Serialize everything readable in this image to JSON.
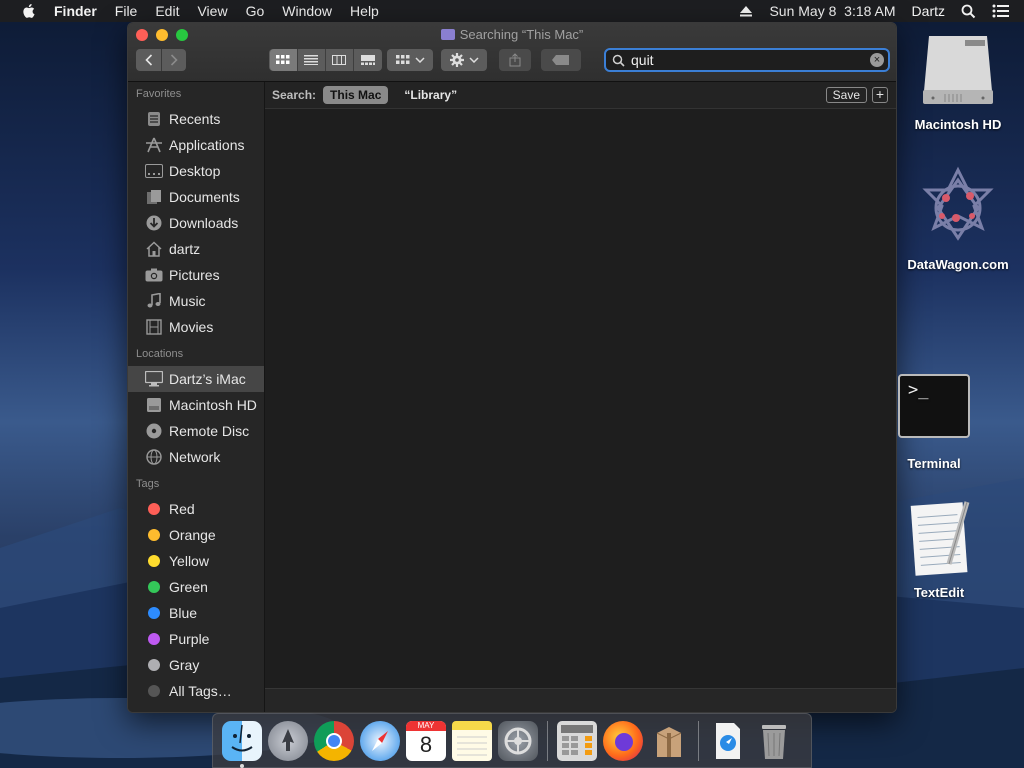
{
  "menubar": {
    "app_name": "Finder",
    "menus": [
      "File",
      "Edit",
      "View",
      "Go",
      "Window",
      "Help"
    ],
    "clock": "Sun May 8  3:18 AM",
    "user": "Dartz"
  },
  "window": {
    "title": "Searching “This Mac”",
    "search": {
      "value": "quit"
    },
    "scope": {
      "label": "Search:",
      "selected": "This Mac",
      "other": "“Library”",
      "save_label": "Save",
      "add_label": "+"
    }
  },
  "sidebar": {
    "favorites_header": "Favorites",
    "favorites": [
      {
        "label": "Recents",
        "icon": "recents-icon"
      },
      {
        "label": "Applications",
        "icon": "applications-icon"
      },
      {
        "label": "Desktop",
        "icon": "desktop-icon"
      },
      {
        "label": "Documents",
        "icon": "documents-icon"
      },
      {
        "label": "Downloads",
        "icon": "downloads-icon"
      },
      {
        "label": "dartz",
        "icon": "home-icon"
      },
      {
        "label": "Pictures",
        "icon": "camera-icon"
      },
      {
        "label": "Music",
        "icon": "music-note-icon"
      },
      {
        "label": "Movies",
        "icon": "film-icon"
      }
    ],
    "locations_header": "Locations",
    "locations": [
      {
        "label": "Dartz’s iMac",
        "icon": "imac-icon",
        "selected": true
      },
      {
        "label": "Macintosh HD",
        "icon": "hard-drive-icon"
      },
      {
        "label": "Remote Disc",
        "icon": "disc-icon"
      },
      {
        "label": "Network",
        "icon": "globe-icon"
      }
    ],
    "tags_header": "Tags",
    "tags": [
      {
        "label": "Red",
        "color": "#fe5f57"
      },
      {
        "label": "Orange",
        "color": "#febc2e"
      },
      {
        "label": "Yellow",
        "color": "#fedc2e"
      },
      {
        "label": "Green",
        "color": "#34c759"
      },
      {
        "label": "Blue",
        "color": "#2d8cff"
      },
      {
        "label": "Purple",
        "color": "#bf5af2"
      },
      {
        "label": "Gray",
        "color": "#aeaeb2"
      },
      {
        "label": "All Tags…",
        "color": "#555555"
      }
    ]
  },
  "desktop": {
    "icons": [
      {
        "label": "Macintosh HD",
        "icon": "hard-drive-icon"
      },
      {
        "label": "DataWagon.com",
        "icon": "datawagon-icon"
      },
      {
        "label": "Terminal",
        "icon": "terminal-icon",
        "glyph": ">_"
      },
      {
        "label": "TextEdit",
        "icon": "textedit-icon"
      }
    ]
  },
  "dock": {
    "apps": [
      "finder-icon",
      "launchpad-icon",
      "chrome-icon",
      "safari-icon",
      "calendar-icon",
      "notes-icon",
      "system-preferences-icon",
      "calculator-icon",
      "firefox-icon",
      "archive-utility-icon",
      "downloads-stack-icon",
      "trash-icon"
    ],
    "calendar": {
      "month": "MAY",
      "day": "8"
    }
  }
}
